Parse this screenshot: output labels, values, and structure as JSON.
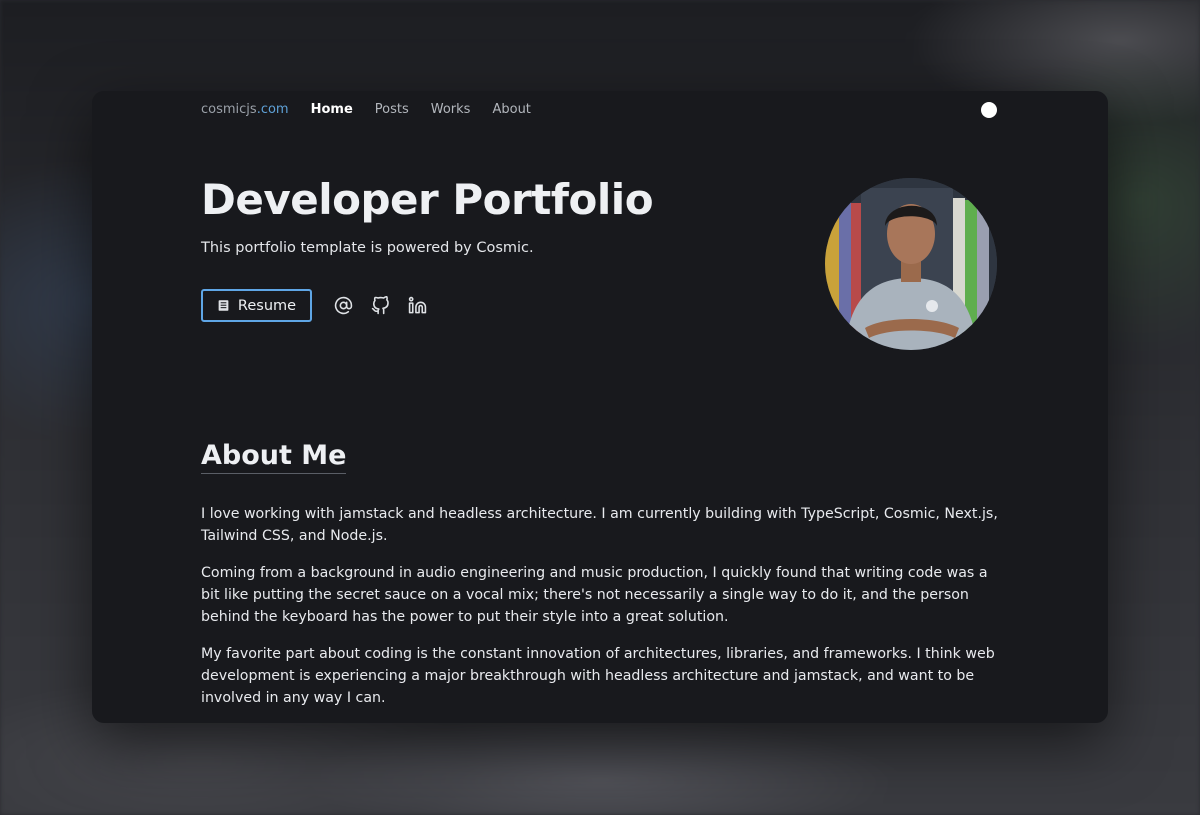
{
  "nav": {
    "brand_name": "cosmicjs",
    "brand_tld": ".com",
    "items": [
      {
        "label": "Home",
        "active": true
      },
      {
        "label": "Posts",
        "active": false
      },
      {
        "label": "Works",
        "active": false
      },
      {
        "label": "About",
        "active": false
      }
    ]
  },
  "hero": {
    "title": "Developer Portfolio",
    "subtitle": "This portfolio template is powered by Cosmic.",
    "resume_label": "Resume",
    "social_icons": [
      "at-sign-icon",
      "github-icon",
      "linkedin-icon"
    ]
  },
  "about": {
    "heading": "About Me",
    "paragraphs": [
      "I love working with jamstack and headless architecture. I am currently building with TypeScript, Cosmic, Next.js, Tailwind CSS, and Node.js.",
      "Coming from a background in audio engineering and music production, I quickly found that writing code was a bit like putting the secret sauce on a vocal mix; there's not necessarily a single way to do it, and the person behind the keyboard has the power to put their style into a great solution.",
      "My favorite part about coding is the constant innovation of architectures, libraries, and frameworks. I think web development is experiencing a major breakthrough with headless architecture and jamstack, and want to be involved in any way I can."
    ]
  },
  "colors": {
    "background": "#18191d",
    "accent": "#5fa6e6",
    "text": "#eef0f3"
  }
}
